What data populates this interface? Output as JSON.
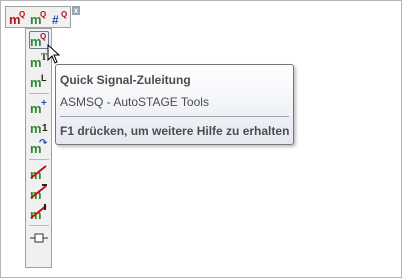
{
  "top_toolbar": {
    "buttons": [
      {
        "icon": "m-q-signal-icon",
        "letter": "m",
        "sup": "Q"
      },
      {
        "icon": "m-q-alt-signal-icon",
        "letter": "m",
        "sup": "Q"
      },
      {
        "icon": "hash-q-signal-icon",
        "letter": "#",
        "sup": "Q"
      }
    ],
    "close_glyph": "x"
  },
  "side_toolbar": {
    "buttons": [
      {
        "icon": "quick-signal-feed-icon",
        "letter": "m",
        "sup": "Q"
      },
      {
        "icon": "m-t-signal-icon",
        "letter": "m",
        "sup": "T"
      },
      {
        "icon": "m-l-signal-icon",
        "letter": "m",
        "sup": "L"
      },
      {
        "icon": "m-plus-signal-icon",
        "letter": "m",
        "sup": "+"
      },
      {
        "icon": "m-one-signal-icon",
        "letter": "m",
        "sup": "1"
      },
      {
        "icon": "m-refresh-signal-icon",
        "letter": "m",
        "sup": "↷"
      },
      {
        "icon": "signal-strike-icon",
        "letter": "m",
        "sup": ""
      },
      {
        "icon": "signal-strike-t-icon",
        "letter": "m",
        "sup": ""
      },
      {
        "icon": "signal-strike-l-icon",
        "letter": "m",
        "sup": ""
      },
      {
        "icon": "connector-icon",
        "letter": "",
        "sup": ""
      }
    ]
  },
  "tooltip": {
    "title": "Quick Signal-Zuleitung",
    "description": "ASMSQ - AutoSTAGE Tools",
    "help": "F1 drücken, um weitere Hilfe zu erhalten"
  },
  "colors": {
    "m_green": "#2e8b2e",
    "m_red": "#b01818",
    "hash_blue": "#2a4fb0",
    "sup_red": "#c01010",
    "tooltip_text": "#4c4c4c"
  }
}
